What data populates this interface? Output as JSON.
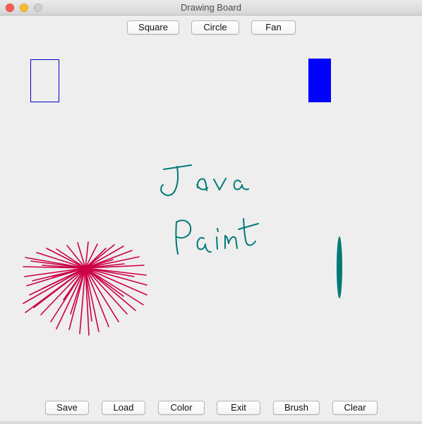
{
  "window": {
    "title": "Drawing Board",
    "controls": [
      "close",
      "minimize",
      "zoom"
    ]
  },
  "toolbar_top": {
    "buttons": [
      "Square",
      "Circle",
      "Fan"
    ]
  },
  "toolbar_bottom": {
    "buttons": [
      "Save",
      "Load",
      "Color",
      "Exit",
      "Brush",
      "Clear"
    ]
  },
  "canvas": {
    "shapes": [
      {
        "name": "outlined-rectangle",
        "kind": "rect",
        "style": "outline",
        "color": "#0000cc"
      },
      {
        "name": "filled-rectangle",
        "kind": "rect",
        "style": "filled",
        "color": "#0000ff"
      },
      {
        "name": "fan-drawing",
        "kind": "fan",
        "color": "#cc0044"
      },
      {
        "name": "brush-ellipse",
        "kind": "ellipse",
        "style": "filled",
        "color": "#007a78"
      }
    ],
    "handwriting": {
      "lines": [
        "Java",
        "Paint"
      ],
      "color": "#007a78"
    }
  }
}
